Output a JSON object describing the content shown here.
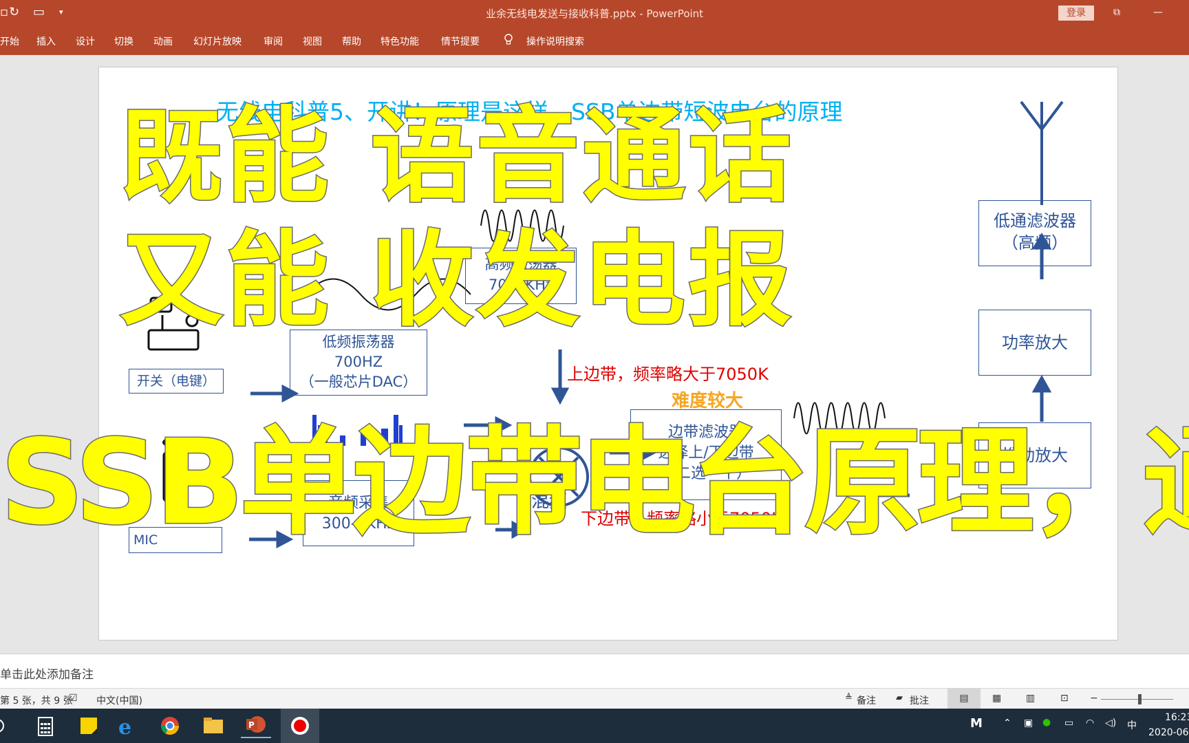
{
  "app": {
    "window_title": "业余无线电发送与接收科普.pptx  -  PowerPoint",
    "login_label": "登录"
  },
  "ribbon": {
    "tabs": [
      "开始",
      "插入",
      "设计",
      "切换",
      "动画",
      "幻灯片放映",
      "审阅",
      "视图",
      "帮助",
      "特色功能",
      "情节提要"
    ],
    "search_label": "操作说明搜索"
  },
  "slide": {
    "title": "无线电科普5、开讲！原理是这样，SSB单边带短波电台的原理",
    "boxes": {
      "switch_key": "开关（电键）",
      "low_osc": [
        "低频振荡器",
        "700HZ",
        "（一般芯片DAC）"
      ],
      "high_osc": [
        "高频振荡器",
        "7050KHz"
      ],
      "lowpass": [
        "低通滤波器",
        "（高频）"
      ],
      "power_amp": "功率放大",
      "sideband_filter": [
        "边带滤波器",
        "选择上/下边带",
        "（二选一个）"
      ],
      "driver": "推动放大",
      "audio": [
        "音频采集",
        "300-3KHz"
      ],
      "mic": "MIC"
    },
    "labels": {
      "upper_sideband": "上边带，频率略大于7050K",
      "difficulty": "难度较大",
      "lower_sideband": "下边带，频率略小于7050K",
      "mixer": "混频"
    }
  },
  "overlay": {
    "line1": "既能 语音通话",
    "line2": "又能 收发电报",
    "line3": "SSB单边带电台原理，通俗易懂"
  },
  "notes": {
    "placeholder": "单击此处添加备注"
  },
  "statusbar": {
    "slide_info": "第 5 张，共 9 张",
    "language": "中文(中国)",
    "notes_btn": "备注",
    "comments_btn": "批注"
  },
  "taskbar": {
    "ime": "中",
    "time": "16:23",
    "date": "2020-06"
  },
  "colors": {
    "ppt_red": "#b7472a",
    "box_blue": "#2f5597",
    "title_cyan": "#00b0f0",
    "overlay_yellow": "#ffff00"
  }
}
